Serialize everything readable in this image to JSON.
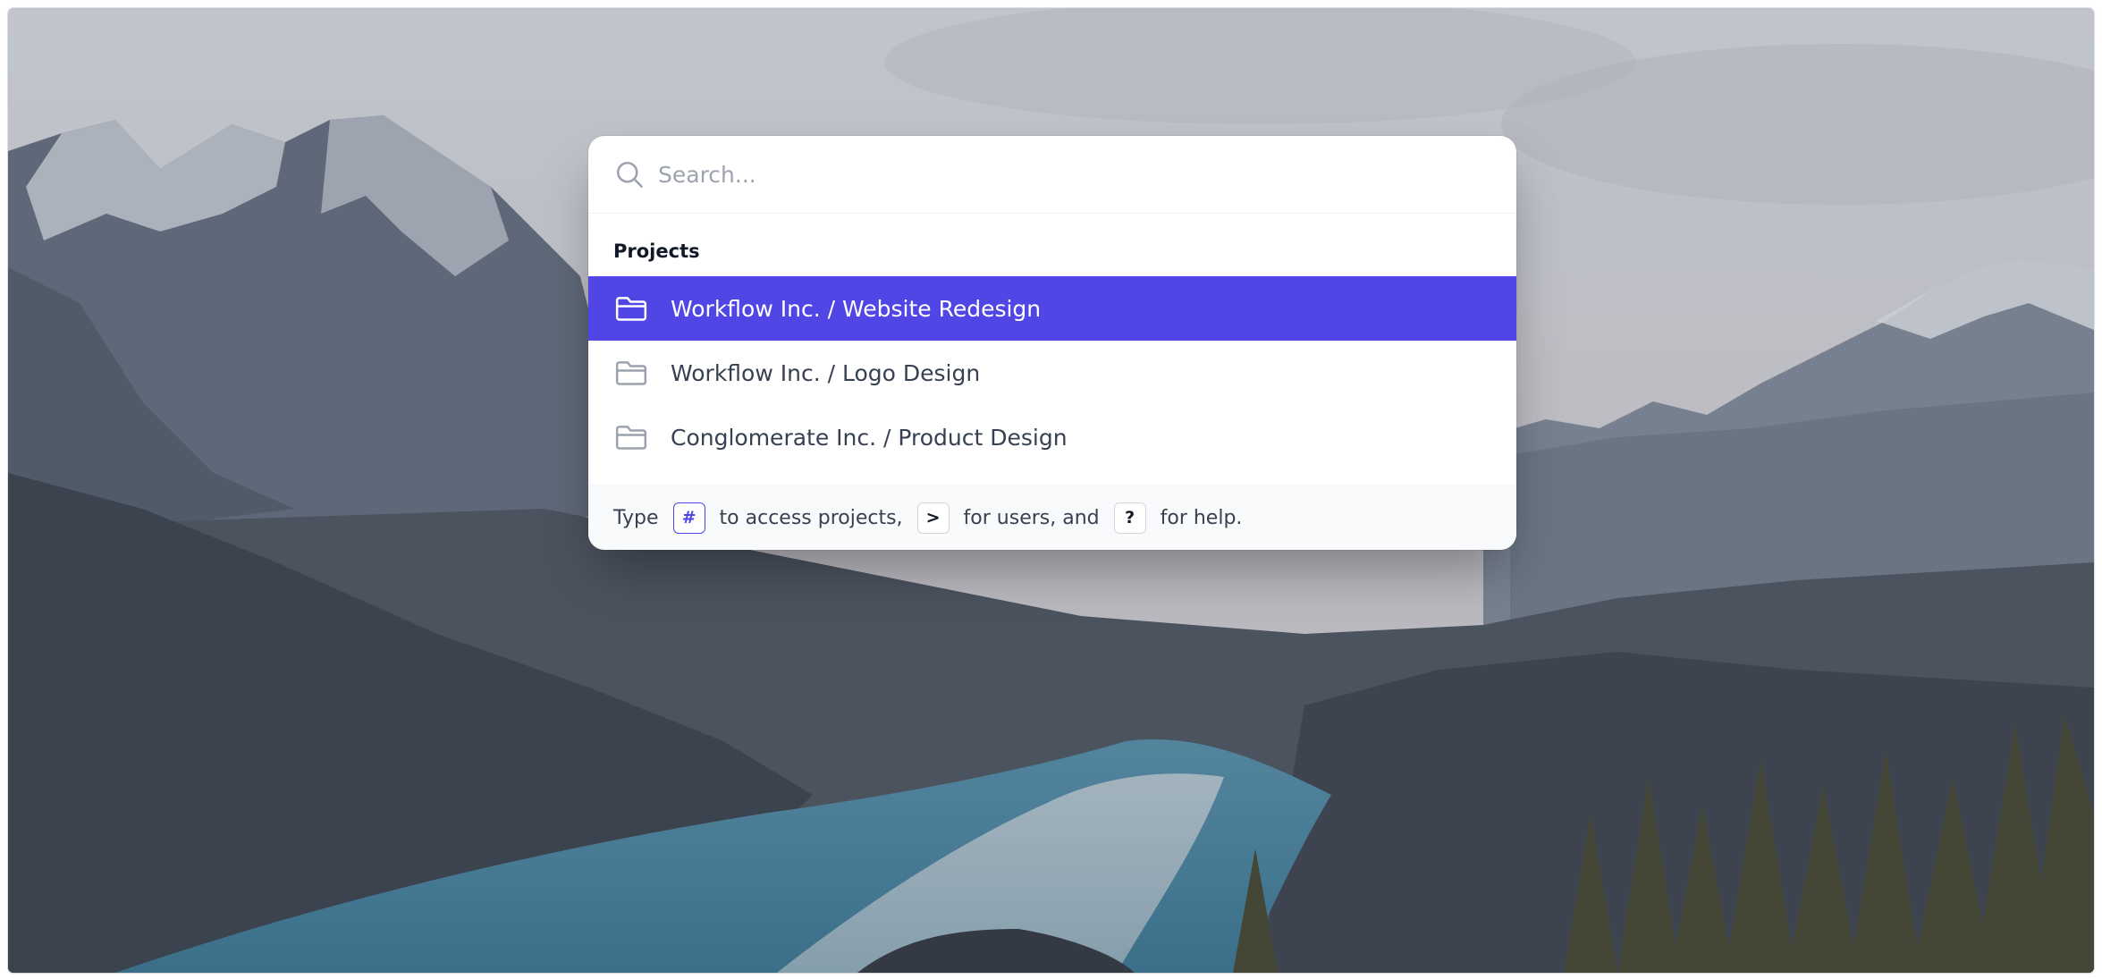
{
  "search": {
    "placeholder": "Search...",
    "value": ""
  },
  "projects": {
    "section_title": "Projects",
    "items": [
      {
        "label": "Workflow Inc. / Website Redesign",
        "active": true
      },
      {
        "label": "Workflow Inc. / Logo Design",
        "active": false
      },
      {
        "label": "Conglomerate Inc. / Product Design",
        "active": false
      }
    ]
  },
  "footer": {
    "part1": "Type",
    "key_projects": "#",
    "part2": "to access projects,",
    "key_users": ">",
    "part3": "for users, and",
    "key_help": "?",
    "part4": "for help."
  },
  "colors": {
    "accent": "#4f46e5",
    "text_primary": "#111827",
    "text_secondary": "#374151",
    "muted": "#9ca3af",
    "footer_bg": "#f9fafb"
  },
  "icons": {
    "search": "magnifier-icon",
    "project": "folder-icon"
  }
}
